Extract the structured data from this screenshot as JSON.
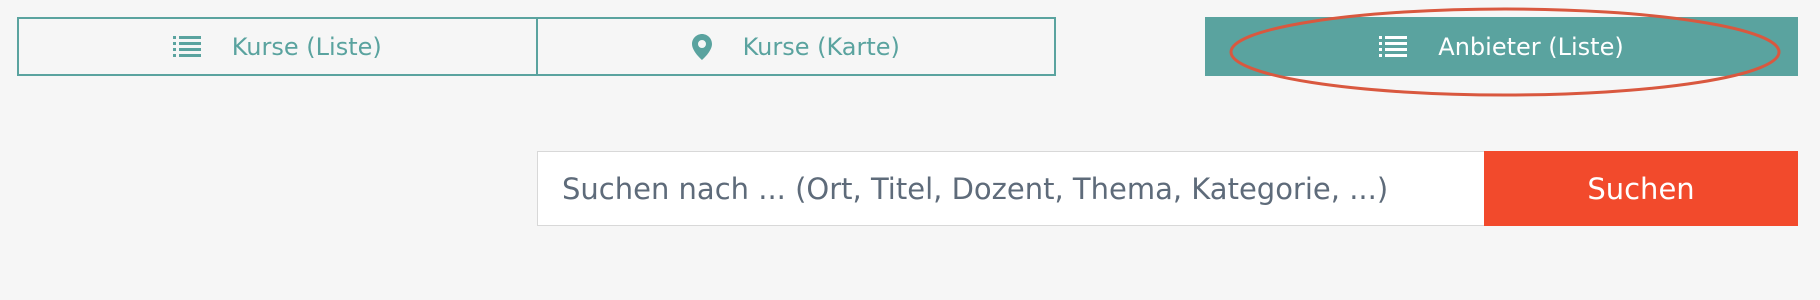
{
  "view_tabs": [
    {
      "label": "Kurse (Liste)",
      "icon": "list-icon"
    },
    {
      "label": "Kurse (Karte)",
      "icon": "map-pin-icon"
    }
  ],
  "provider_button": {
    "label": "Anbieter (Liste)",
    "icon": "list-icon"
  },
  "search": {
    "placeholder": "Suchen nach ... (Ort, Titel, Dozent, Thema, Kategorie, ...)",
    "button_label": "Suchen"
  },
  "colors": {
    "accent": "#5aa39f",
    "search_button": "#f24a2c",
    "background": "#f6f6f6",
    "annotation": "#d9583f"
  }
}
